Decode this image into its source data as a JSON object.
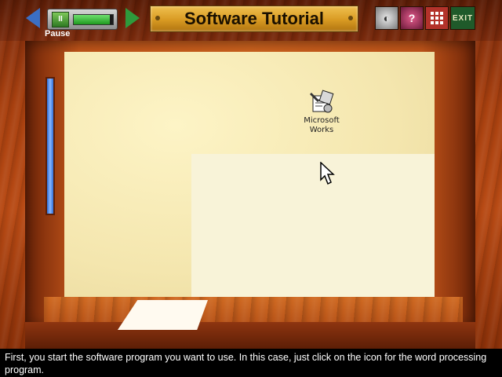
{
  "header": {
    "title": "Software Tutorial",
    "pause_label": "Pause",
    "progress": 0.92,
    "buttons": {
      "info_icon": "info-icon",
      "help_icon": "help-icon",
      "menu_icon": "menu-grid-icon",
      "exit_label": "EXIT"
    }
  },
  "desktop": {
    "icon": {
      "name": "Microsoft Works",
      "label_line1": "Microsoft",
      "label_line2": "Works"
    }
  },
  "caption": {
    "text": "First, you start the software program you want to use. In this case, just click on the icon for the word processing program."
  },
  "colors": {
    "back_arrow": "#3b6fc4",
    "forward_arrow": "#2e9a3c",
    "title_plate": "#d89a22",
    "caption_bg": "#000000"
  }
}
